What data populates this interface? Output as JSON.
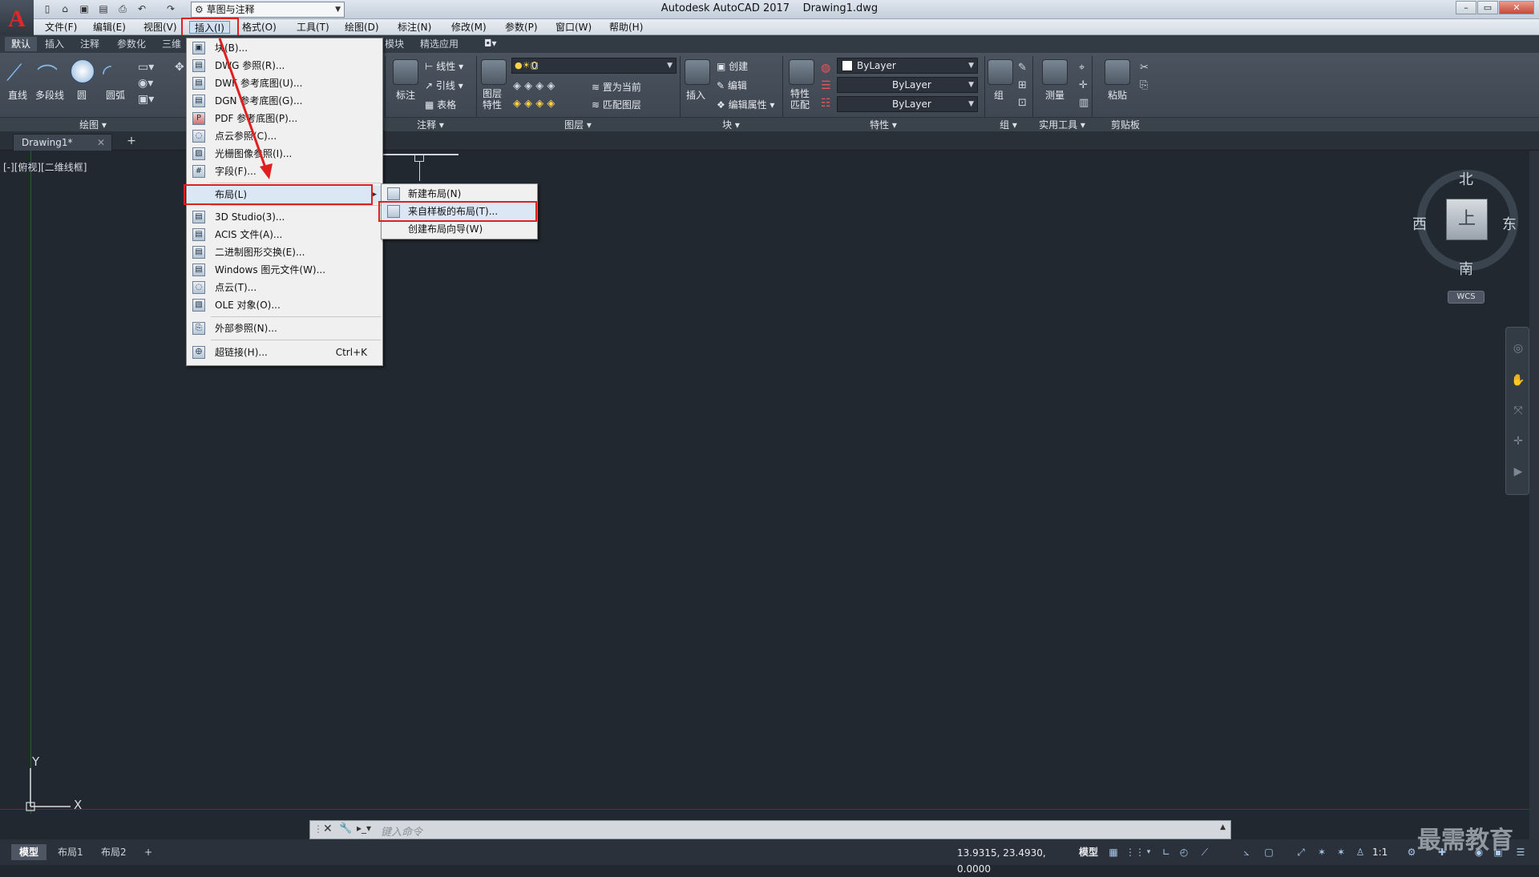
{
  "app": {
    "title": "Autodesk AutoCAD 2017",
    "filename": "Drawing1.dwg",
    "logo": "A",
    "workspace": "草图与注释"
  },
  "window_controls": {
    "min": "–",
    "max": "▭",
    "close": "✕"
  },
  "menubar": [
    "文件(F)",
    "编辑(E)",
    "视图(V)",
    "插入(I)",
    "格式(O)",
    "工具(T)",
    "绘图(D)",
    "标注(N)",
    "修改(M)",
    "参数(P)",
    "窗口(W)",
    "帮助(H)"
  ],
  "ribbon_tabs": [
    "默认",
    "插入",
    "注释",
    "参数化",
    "三维",
    "模块",
    "精选应用"
  ],
  "ribbon": {
    "draw": {
      "line": "直线",
      "polyline": "多段线",
      "circle": "圆",
      "arc": "圆弧",
      "footer": "绘图 ▾"
    },
    "annotation": {
      "dim": "标注",
      "linear": "线性",
      "leader": "引线",
      "table": "表格",
      "footer": "注释 ▾"
    },
    "layers": {
      "props": "图层特性",
      "current": "0",
      "set_current": "置为当前",
      "match": "匹配图层",
      "footer": "图层 ▾"
    },
    "block": {
      "insert": "插入",
      "create": "创建",
      "edit": "编辑",
      "edit_attr": "编辑属性",
      "footer": "块 ▾"
    },
    "properties": {
      "match": "特性匹配",
      "color": "ByLayer",
      "linetype": "ByLayer",
      "lineweight": "ByLayer",
      "footer": "特性 ▾"
    },
    "groups": {
      "group": "组",
      "footer": "组 ▾"
    },
    "utilities": {
      "measure": "测量",
      "footer": "实用工具 ▾"
    },
    "clipboard": {
      "paste": "粘贴",
      "footer": "剪贴板"
    }
  },
  "doc_tabs": {
    "active": "Drawing1*",
    "close": "✕",
    "add": "+"
  },
  "viewport_label": "[-][俯视][二维线框]",
  "insert_menu": [
    {
      "label": "块(B)...",
      "shortcut": ""
    },
    {
      "label": "DWG 参照(R)...",
      "shortcut": ""
    },
    {
      "label": "DWF 参考底图(U)...",
      "shortcut": ""
    },
    {
      "label": "DGN 参考底图(G)...",
      "shortcut": ""
    },
    {
      "label": "PDF 参考底图(P)...",
      "shortcut": ""
    },
    {
      "label": "点云参照(C)...",
      "shortcut": ""
    },
    {
      "label": "光栅图像参照(I)...",
      "shortcut": ""
    },
    {
      "label": "字段(F)...",
      "shortcut": ""
    },
    {
      "label": "布局(L)",
      "shortcut": ""
    },
    {
      "label": "3D Studio(3)...",
      "shortcut": ""
    },
    {
      "label": "ACIS 文件(A)...",
      "shortcut": ""
    },
    {
      "label": "二进制图形交换(E)...",
      "shortcut": ""
    },
    {
      "label": "Windows 图元文件(W)...",
      "shortcut": ""
    },
    {
      "label": "点云(T)...",
      "shortcut": ""
    },
    {
      "label": "OLE 对象(O)...",
      "shortcut": ""
    },
    {
      "label": "外部参照(N)...",
      "shortcut": ""
    },
    {
      "label": "超链接(H)...",
      "shortcut": "Ctrl+K"
    }
  ],
  "layout_submenu": [
    "新建布局(N)",
    "来自样板的布局(T)...",
    "创建布局向导(W)"
  ],
  "command_line": {
    "placeholder": "键入命令"
  },
  "layout_tabs": [
    "模型",
    "布局1",
    "布局2",
    "+"
  ],
  "status": {
    "coords": "13.9315, 23.4930, 0.0000",
    "model": "模型",
    "scale": "1:1"
  },
  "viewcube": {
    "north": "北",
    "south": "南",
    "east": "东",
    "west": "西",
    "top": "上",
    "wcs": "WCS"
  },
  "ucs": {
    "x": "X",
    "y": "Y"
  },
  "watermark": "最需教育"
}
